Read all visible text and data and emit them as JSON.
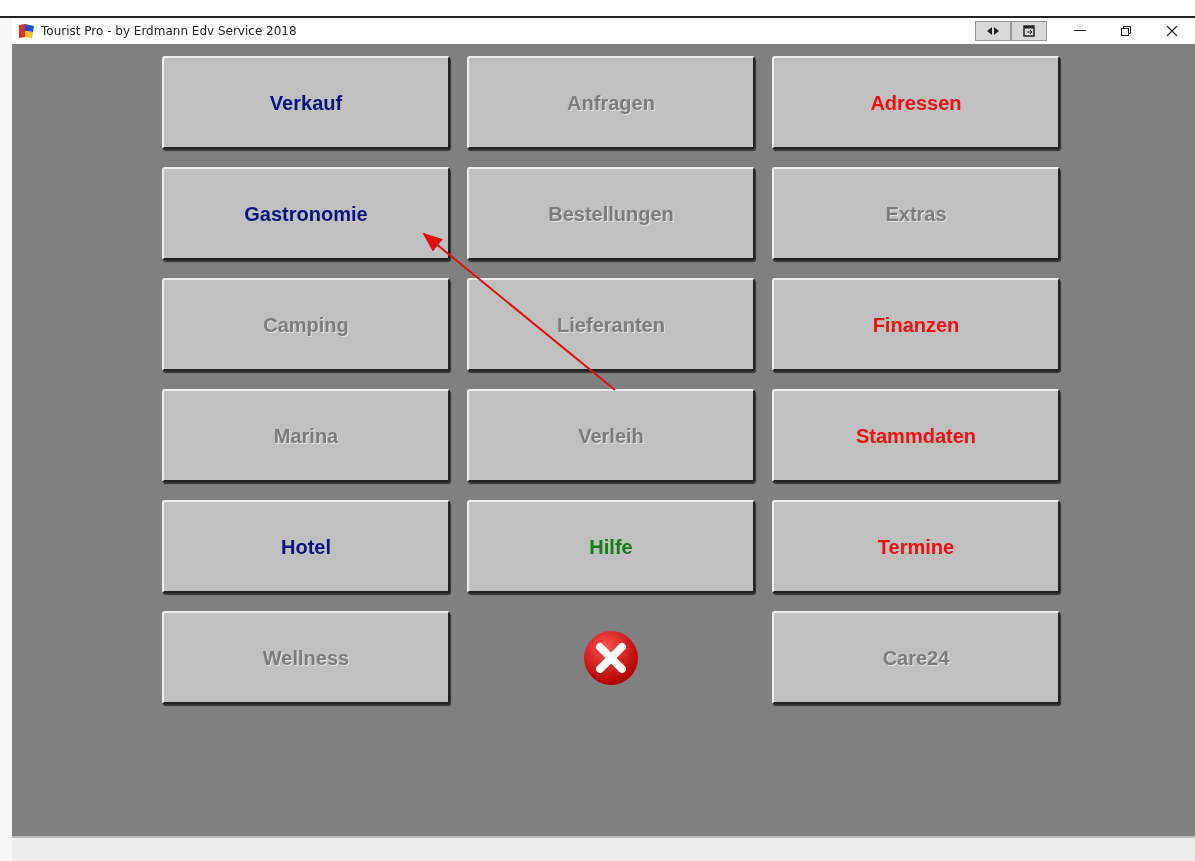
{
  "window": {
    "title": "Tourist Pro - by Erdmann Edv Service 2018"
  },
  "menu_buttons": [
    {
      "kind": "button",
      "label": "Verkauf",
      "disabled": false,
      "color": "#0a1480"
    },
    {
      "kind": "button",
      "label": "Anfragen",
      "disabled": true
    },
    {
      "kind": "button",
      "label": "Adressen",
      "disabled": false,
      "color": "#f01010"
    },
    {
      "kind": "button",
      "label": "Gastronomie",
      "disabled": false,
      "color": "#0a1480"
    },
    {
      "kind": "button",
      "label": "Bestellungen",
      "disabled": true
    },
    {
      "kind": "button",
      "label": "Extras",
      "disabled": true
    },
    {
      "kind": "button",
      "label": "Camping",
      "disabled": true
    },
    {
      "kind": "button",
      "label": "Lieferanten",
      "disabled": true
    },
    {
      "kind": "button",
      "label": "Finanzen",
      "disabled": false,
      "color": "#f01010"
    },
    {
      "kind": "button",
      "label": "Marina",
      "disabled": true
    },
    {
      "kind": "button",
      "label": "Verleih",
      "disabled": true
    },
    {
      "kind": "button",
      "label": "Stammdaten",
      "disabled": false,
      "color": "#f01010"
    },
    {
      "kind": "button",
      "label": "Hotel",
      "disabled": false,
      "color": "#0a1480"
    },
    {
      "kind": "button",
      "label": "Hilfe",
      "disabled": false,
      "color": "#128012"
    },
    {
      "kind": "button",
      "label": "Termine",
      "disabled": false,
      "color": "#f01010"
    },
    {
      "kind": "button",
      "label": "Wellness",
      "disabled": true
    },
    {
      "kind": "close"
    },
    {
      "kind": "button",
      "label": "Care24",
      "disabled": true
    }
  ]
}
